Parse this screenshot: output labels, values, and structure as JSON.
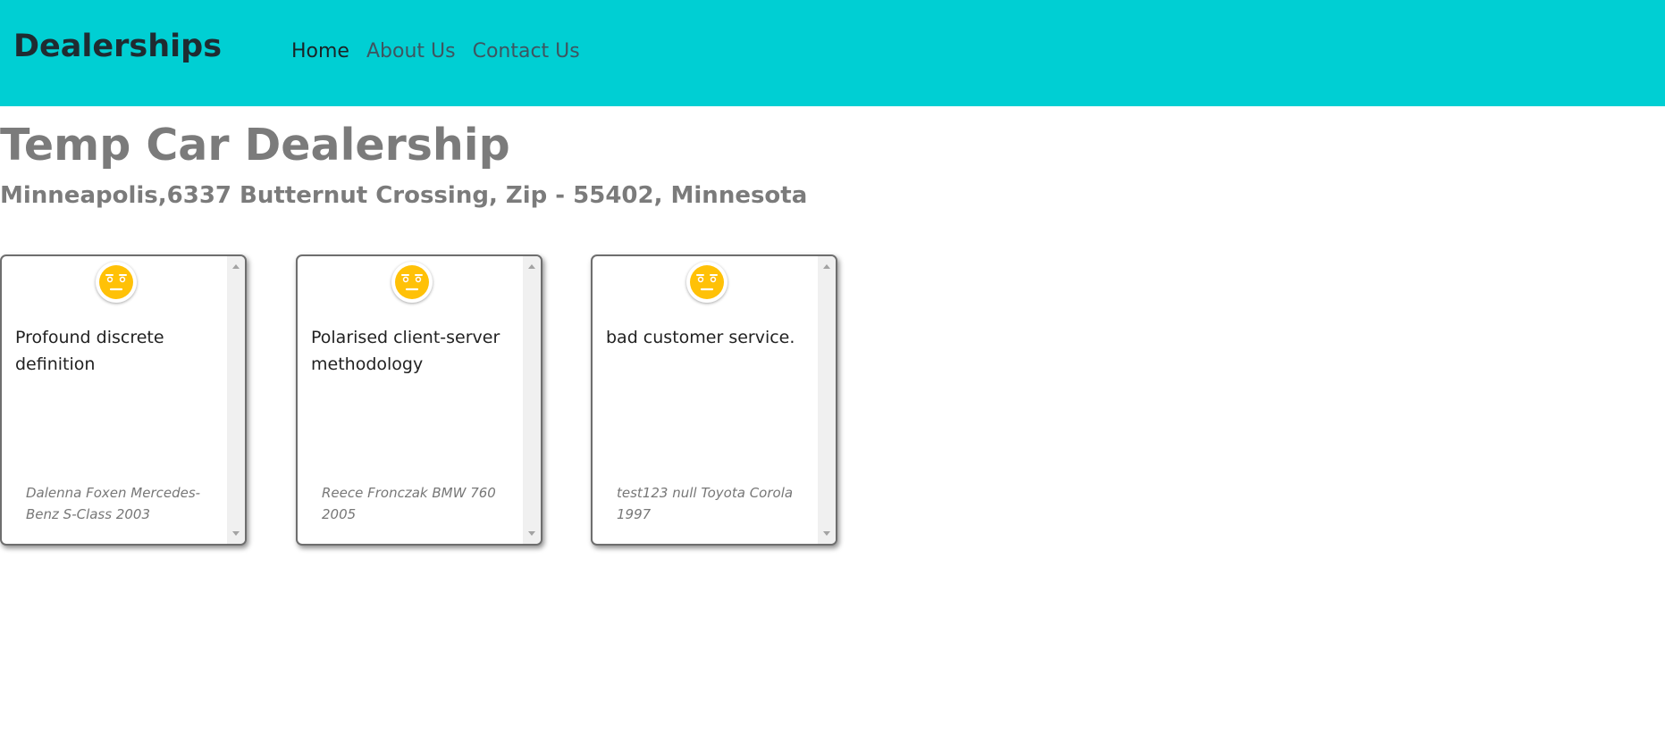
{
  "navbar": {
    "brand": "Dealerships",
    "links": [
      {
        "label": "Home",
        "active": true
      },
      {
        "label": "About Us",
        "active": false
      },
      {
        "label": "Contact Us",
        "active": false
      }
    ],
    "background_color": "#00cfd3"
  },
  "dealer": {
    "name": "Temp Car Dealership",
    "address": "Minneapolis,6337 Butternut Crossing, Zip - 55402, Minnesota"
  },
  "reviews": [
    {
      "sentiment_icon": "neutral-face-icon",
      "text": "Profound discrete definition",
      "reviewer": "Dalenna Foxen Mercedes-Benz S-Class 2003"
    },
    {
      "sentiment_icon": "neutral-face-icon",
      "text": "Polarised client-server methodology",
      "reviewer": "Reece Fronczak BMW 760 2005"
    },
    {
      "sentiment_icon": "neutral-face-icon",
      "text": "bad customer service.",
      "reviewer": "test123 null Toyota Corola 1997"
    }
  ],
  "colors": {
    "face_fill": "#ffc107",
    "heading_gray": "#7b7b7b"
  }
}
